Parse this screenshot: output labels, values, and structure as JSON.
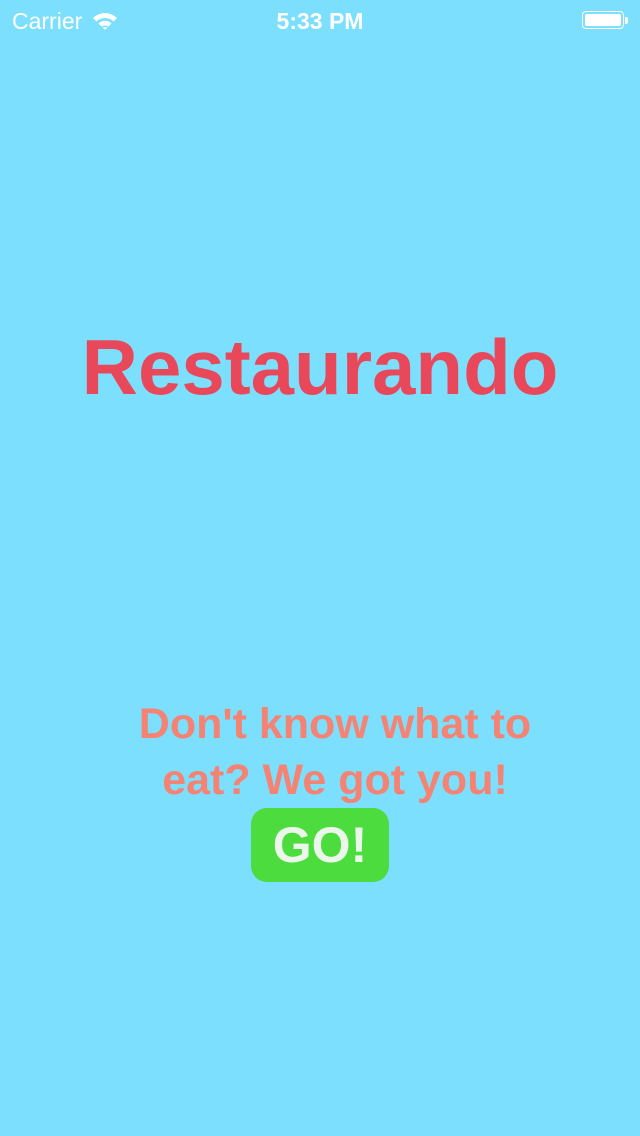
{
  "status_bar": {
    "carrier": "Carrier",
    "time": "5:33 PM",
    "icons": [
      "wifi-icon",
      "battery-icon"
    ]
  },
  "main": {
    "title": "Restaurando",
    "tagline": "Don't know what to eat? We got you!",
    "go_button_label": "GO!"
  },
  "colors": {
    "background": "#7cdffe",
    "title": "#e8485a",
    "tagline": "#f58373",
    "go_button": "#4ddc3d",
    "go_button_text": "#ecf7ec",
    "status_text": "#ffffff"
  }
}
